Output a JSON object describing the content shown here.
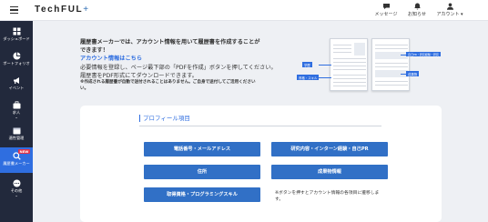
{
  "header": {
    "logo": "TechFUL",
    "logo_mark": "+",
    "nav": [
      {
        "label": "メッセージ",
        "icon": "message-icon"
      },
      {
        "label": "お知らせ",
        "icon": "bell-icon"
      },
      {
        "label": "アカウント",
        "icon": "account-icon"
      }
    ]
  },
  "sidebar": {
    "items": [
      {
        "label": "ダッシュボード",
        "icon": "dashboard-icon"
      },
      {
        "label": "ポートフォリオ",
        "icon": "portfolio-icon"
      },
      {
        "label": "イベント",
        "icon": "megaphone-icon"
      },
      {
        "label": "求人",
        "icon": "briefcase-icon"
      },
      {
        "label": "適性管理",
        "icon": "calendar-icon"
      },
      {
        "label": "履歴書メーカー",
        "icon": "search-icon",
        "badge": "NEW",
        "active": true
      },
      {
        "label": "その他",
        "icon": "more-icon"
      }
    ]
  },
  "intro": {
    "line1": "履歴書メーカーでは、アカウント情報を用いて履歴書を作成することが",
    "line2": "できます！",
    "link": "アカウント情報はこちら",
    "body1": "必要情報を登録し、ページ最下部の「PDFを作成」ボタンを押してください。",
    "body2": "履歴書をPDF形式にてダウンロードできます。",
    "note1": "※作成される履歴書が自動で送付されることはありません。ご自身で送付してご活用ください",
    "note2": "い。"
  },
  "illustration": {
    "tags": [
      "学歴",
      "資格・スキル",
      "自己PR・研究経験・研究",
      "成果物"
    ]
  },
  "profile": {
    "title": "プロフィール項目",
    "buttons": [
      "電話番号・メールアドレス",
      "研究内容・インターン経験・自己PR",
      "住所",
      "成果物情報",
      "取得資格・プログラミングスキル"
    ],
    "hint1": "※ボタンを押すとアカウント情報の各項目に遷移しま",
    "hint2": "す。"
  },
  "colors": {
    "accent": "#2f6ee0",
    "button": "#3170c6",
    "sidebar": "#22293c",
    "badge": "#e0344a"
  }
}
